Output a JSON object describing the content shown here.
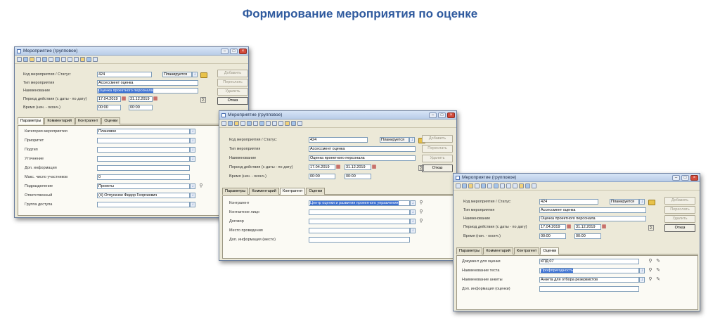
{
  "page": {
    "title": "Формирование мероприятия по оценке"
  },
  "window": {
    "title": "Мероприятие (групповое)",
    "labels": {
      "code_status": "Код мероприятия / Статус:",
      "type": "Тип мероприятия",
      "name": "Наименование",
      "period": "Период действия (с даты - по дату)",
      "time": "Время (нач. - оконч.)"
    },
    "values": {
      "code": "424",
      "status": "Планируется",
      "type": "Ассессмент оценка",
      "name": "Оценка проектного персонала",
      "date_from": "17.04.2019",
      "date_to": "31.12.2019",
      "time_from": "00:00",
      "time_to": "00:00"
    },
    "buttons": {
      "add": "Добавить",
      "resend": "Переслать",
      "delete": "Удалить",
      "cancel": "Отказ"
    },
    "tabs": [
      "Параметры",
      "Комментарий",
      "Контрагент",
      "Оценки"
    ]
  },
  "win1": {
    "params": [
      {
        "label": "Категория мероприятия",
        "value": "Плановое"
      },
      {
        "label": "Приоритет",
        "value": ""
      },
      {
        "label": "Подтип",
        "value": ""
      },
      {
        "label": "Уточнение",
        "value": ""
      },
      {
        "label": "Доп. информация",
        "value": ""
      },
      {
        "label": "Макс. число участников",
        "value": "0"
      },
      {
        "label": "Подразделение",
        "value": "Проекты"
      },
      {
        "label": "Ответственный",
        "value": "(4) Отпускное Федор Георгиевич"
      },
      {
        "label": "Группа доступа",
        "value": ""
      }
    ]
  },
  "win2": {
    "contractor": [
      {
        "label": "Контрагент",
        "value": "Центр оценки и развития проектного управления"
      },
      {
        "label": "Контактное лицо",
        "value": ""
      },
      {
        "label": "Договор",
        "value": ""
      },
      {
        "label": "Место проведения",
        "value": ""
      },
      {
        "label": "Доп. информация (место)",
        "value": ""
      }
    ]
  },
  "win3": {
    "assessments": [
      {
        "label": "Документ для оценки",
        "value": "КПД 07"
      },
      {
        "label": "Наименование теста",
        "value": "Профпригодность"
      },
      {
        "label": "Наименование анкеты",
        "value": "Анкета для отбора резервистов"
      },
      {
        "label": "Доп. информация (оценки)",
        "value": ""
      }
    ]
  },
  "icons": {
    "minimize": "minimize-icon",
    "maximize": "maximize-icon",
    "close": "close-icon",
    "lookup": "lookup-arrow-icon",
    "calendar": "calendar-icon"
  }
}
